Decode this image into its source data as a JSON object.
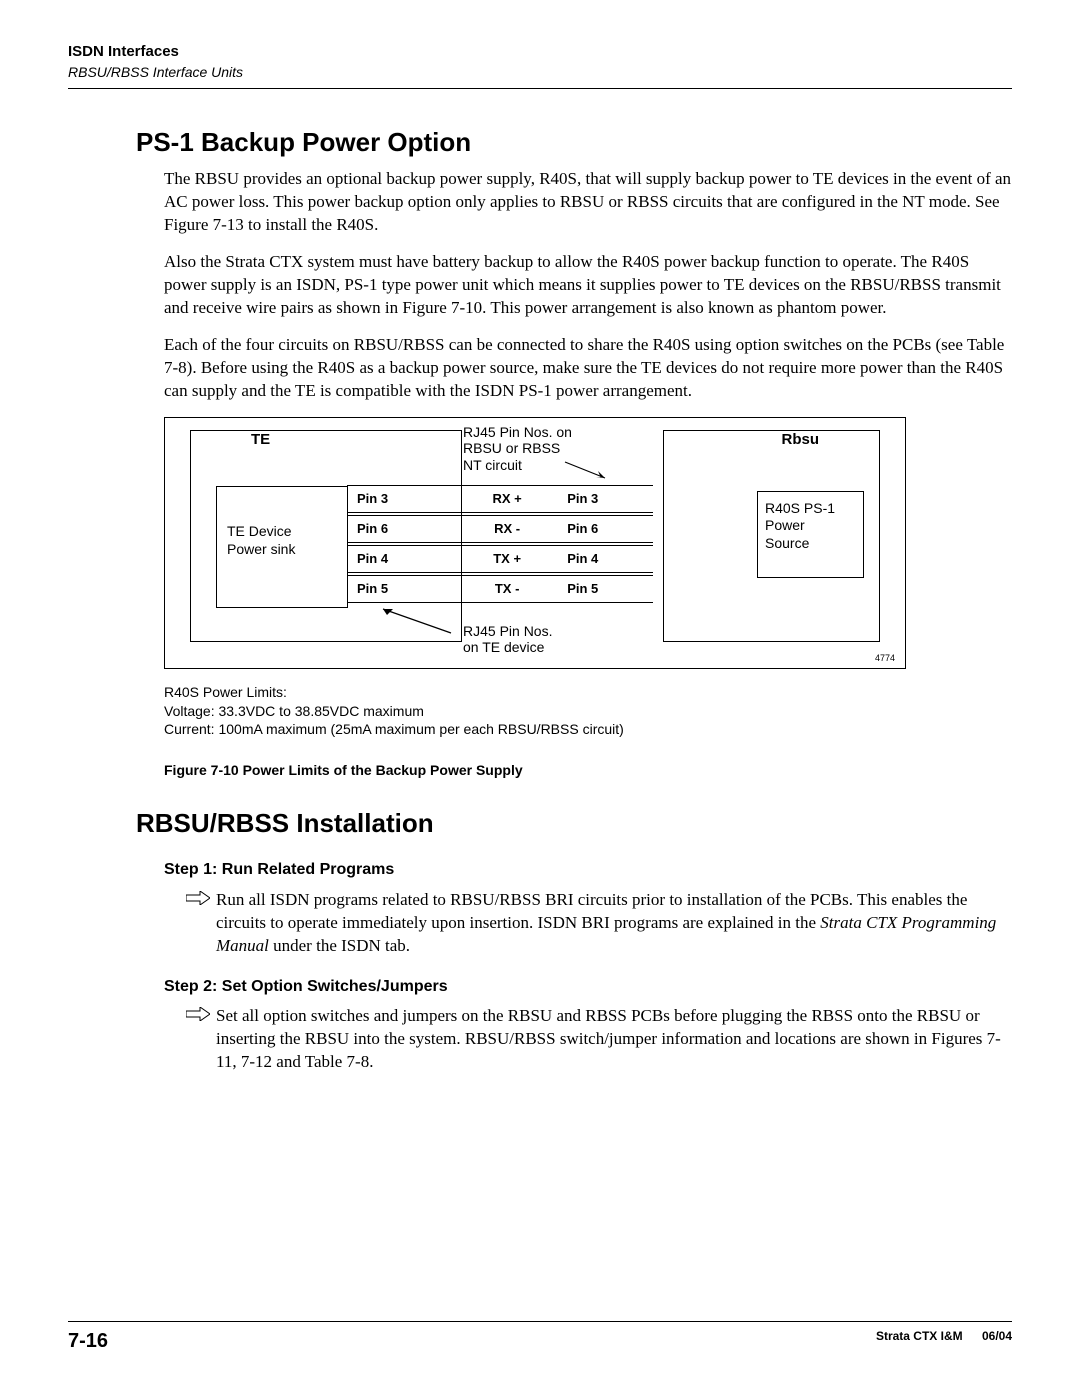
{
  "header": {
    "line1": "ISDN Interfaces",
    "line2": "RBSU/RBSS Interface Units"
  },
  "section1": {
    "title": "PS-1 Backup Power Option",
    "p1": "The RBSU provides an optional backup power supply, R40S, that will supply backup power to TE devices in the event of an AC power loss. This power backup option only applies to RBSU or RBSS circuits that are configured in the NT mode. See Figure 7-13 to install the R40S.",
    "p2": "Also the Strata CTX system must have battery backup to allow the R40S power backup function to operate. The R40S power supply is an ISDN, PS-1 type power unit which means it supplies power to TE devices on the RBSU/RBSS transmit and receive wire pairs as shown in Figure 7-10. This power arrangement is also known as phantom power.",
    "p3": "Each of the four circuits on RBSU/RBSS can be connected to share the R40S using option switches on the PCBs (see Table 7-8). Before using the R40S as a backup power source, make sure the TE devices do not require more power than the R40S can supply and the TE is compatible with the ISDN PS-1 power arrangement."
  },
  "diagram": {
    "te_label": "TE",
    "te_inner": "TE Device\nPower sink",
    "rbsu_label": "Rbsu",
    "rbsu_inner": "R40S PS-1\nPower\nSource",
    "pin_rows": [
      {
        "left": "Pin 3",
        "mid": "RX +",
        "right": "Pin 3"
      },
      {
        "left": "Pin 6",
        "mid": "RX -",
        "right": "Pin 6"
      },
      {
        "left": "Pin 4",
        "mid": "TX +",
        "right": "Pin 4"
      },
      {
        "left": "Pin 5",
        "mid": "TX -",
        "right": "Pin 5"
      }
    ],
    "note_top": "RJ45 Pin Nos. on\nRBSU or RBSS\nNT circuit",
    "note_bottom": "RJ45 Pin Nos.\non TE device",
    "fignum": "4774"
  },
  "power_notes": {
    "l1": "R40S Power Limits:",
    "l2": "Voltage: 33.3VDC to 38.85VDC maximum",
    "l3": "Current: 100mA maximum (25mA maximum per each RBSU/RBSS circuit)"
  },
  "fig_caption": "Figure 7-10  Power Limits of the Backup Power Supply",
  "section2": {
    "title": "RBSU/RBSS Installation",
    "step1_title": "Step 1:  Run Related Programs",
    "step1_text_a": "Run all ISDN programs related to RBSU/RBSS BRI circuits prior to installation of the PCBs. This enables the circuits to operate immediately upon insertion. ISDN BRI programs are explained in the ",
    "step1_text_i": "Strata CTX Programming Manual",
    "step1_text_b": " under the ISDN tab.",
    "step2_title": "Step 2:  Set Option Switches/Jumpers",
    "step2_text": "Set all option switches and jumpers on the RBSU and RBSS PCBs before plugging the RBSS onto the RBSU or inserting the RBSU into the system. RBSU/RBSS switch/jumper information and locations are shown in Figures 7-11, 7-12 and Table 7-8."
  },
  "footer": {
    "page": "7-16",
    "doc": "Strata CTX I&M",
    "date": "06/04"
  }
}
